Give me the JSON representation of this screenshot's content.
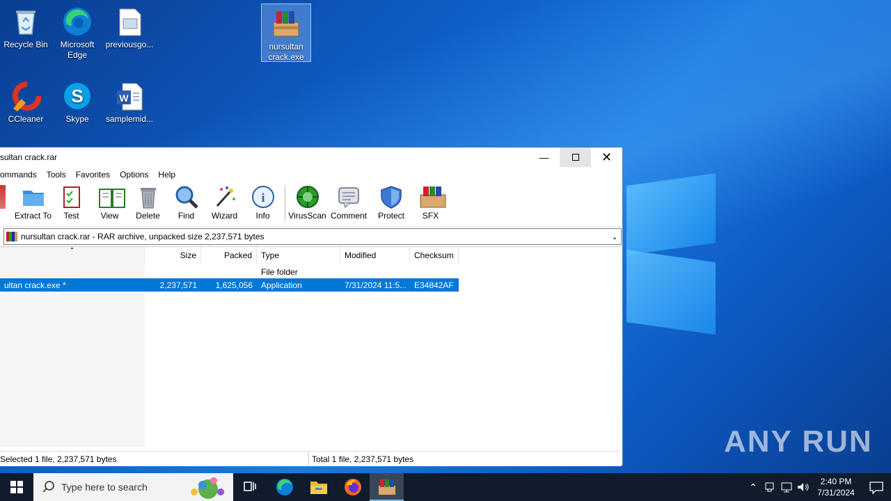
{
  "desktop": {
    "icons": [
      {
        "label": "Recycle Bin",
        "icon": "recycle-bin-icon"
      },
      {
        "label": "Microsoft Edge",
        "icon": "edge-icon"
      },
      {
        "label": "previousgo...",
        "icon": "image-file-icon"
      },
      {
        "label": "nursultan crack.exe",
        "icon": "winrar-archive-icon"
      },
      {
        "label": "CCleaner",
        "icon": "ccleaner-icon"
      },
      {
        "label": "Skype",
        "icon": "skype-icon"
      },
      {
        "label": "samplemid...",
        "icon": "word-document-icon"
      }
    ],
    "watermark": "ANY RUN"
  },
  "window": {
    "title": "sultan crack.rar",
    "menu": [
      "ommands",
      "Tools",
      "Favorites",
      "Options",
      "Help"
    ],
    "toolbar": [
      {
        "label": "Extract To",
        "icon": "extract-to-icon"
      },
      {
        "label": "Test",
        "icon": "test-icon"
      },
      {
        "label": "View",
        "icon": "view-icon"
      },
      {
        "label": "Delete",
        "icon": "delete-icon"
      },
      {
        "label": "Find",
        "icon": "find-icon"
      },
      {
        "label": "Wizard",
        "icon": "wizard-icon"
      },
      {
        "label": "Info",
        "icon": "info-icon"
      },
      {
        "label": "VirusScan",
        "icon": "virusscan-icon"
      },
      {
        "label": "Comment",
        "icon": "comment-icon"
      },
      {
        "label": "Protect",
        "icon": "protect-icon"
      },
      {
        "label": "SFX",
        "icon": "sfx-icon"
      }
    ],
    "path": "nursultan crack.rar - RAR archive, unpacked size 2,237,571 bytes",
    "columns": [
      "Size",
      "Packed",
      "Type",
      "Modified",
      "Checksum"
    ],
    "rows": [
      {
        "name": "",
        "size": "",
        "packed": "",
        "type": "File folder",
        "modified": "",
        "checksum": ""
      },
      {
        "name": "ultan crack.exe *",
        "size": "2,237,571",
        "packed": "1,625,056",
        "type": "Application",
        "modified": "7/31/2024 11:5...",
        "checksum": "E34842AF"
      }
    ],
    "status_left": "Selected 1 file, 2,237,571 bytes",
    "status_right": "Total 1 file, 2,237,571 bytes"
  },
  "taskbar": {
    "search_placeholder": "Type here to search",
    "time": "2:40 PM",
    "date": "7/31/2024"
  },
  "colors": {
    "selection": "#0078d7",
    "taskbar": "#101c2c",
    "desktop": "#0f5fc7"
  }
}
